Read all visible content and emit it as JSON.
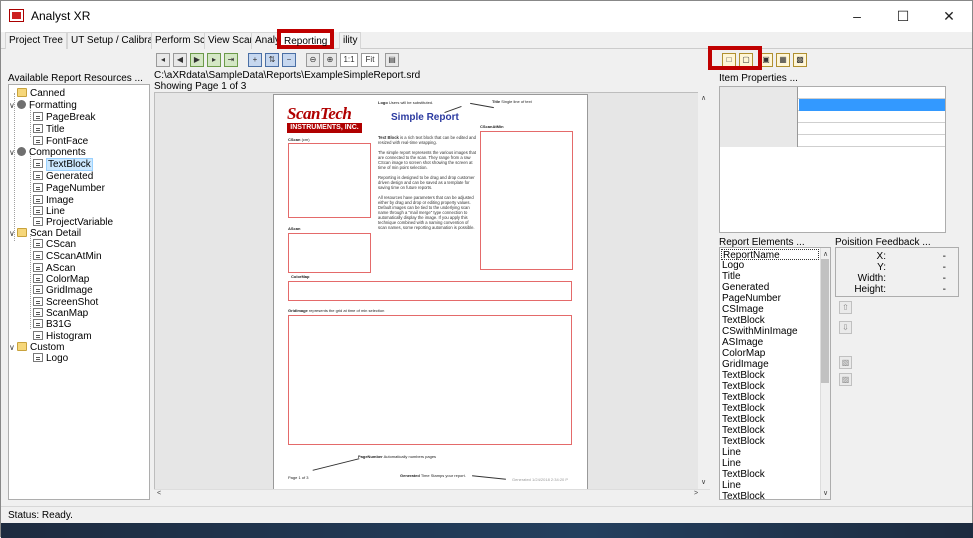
{
  "window": {
    "title": "Analyst XR",
    "minimize": "–",
    "maximize": "☐",
    "close": "✕"
  },
  "tabs": [
    {
      "label": "Project Tree"
    },
    {
      "label": "UT Setup / Calibration"
    },
    {
      "label": "Perform Scan"
    },
    {
      "label": "View Scan"
    },
    {
      "label": "Analysis"
    },
    {
      "label": "Reporting",
      "active": true
    },
    {
      "label": "ility"
    }
  ],
  "left_panel": {
    "label": "Available Report Resources ...",
    "tree": [
      {
        "label": "Canned",
        "icon": "folder-icon",
        "level": 0
      },
      {
        "label": "Formatting",
        "icon": "components-icon",
        "level": 0,
        "expanded": true
      },
      {
        "label": "PageBreak",
        "icon": "doc-icon",
        "level": 1
      },
      {
        "label": "Title",
        "icon": "doc-icon",
        "level": 1
      },
      {
        "label": "FontFace",
        "icon": "doc-icon",
        "level": 1
      },
      {
        "label": "Components",
        "icon": "components-icon",
        "level": 0,
        "expanded": true
      },
      {
        "label": "TextBlock",
        "icon": "doc-icon",
        "level": 1,
        "selected": true
      },
      {
        "label": "Generated",
        "icon": "doc-icon",
        "level": 1
      },
      {
        "label": "PageNumber",
        "icon": "doc-icon",
        "level": 1
      },
      {
        "label": "Image",
        "icon": "doc-icon",
        "level": 1
      },
      {
        "label": "Line",
        "icon": "doc-icon",
        "level": 1
      },
      {
        "label": "ProjectVariable",
        "icon": "doc-icon",
        "level": 1
      },
      {
        "label": "Scan Detail",
        "icon": "folder-icon",
        "level": 0,
        "expanded": true
      },
      {
        "label": "CScan",
        "icon": "doc-icon",
        "level": 1
      },
      {
        "label": "CScanAtMin",
        "icon": "doc-icon",
        "level": 1
      },
      {
        "label": "AScan",
        "icon": "doc-icon",
        "level": 1
      },
      {
        "label": "ColorMap",
        "icon": "doc-icon",
        "level": 1
      },
      {
        "label": "GridImage",
        "icon": "doc-icon",
        "level": 1
      },
      {
        "label": "ScreenShot",
        "icon": "doc-icon",
        "level": 1
      },
      {
        "label": "ScanMap",
        "icon": "doc-icon",
        "level": 1
      },
      {
        "label": "B31G",
        "icon": "doc-icon",
        "level": 1
      },
      {
        "label": "Histogram",
        "icon": "doc-icon",
        "level": 1
      },
      {
        "label": "Custom",
        "icon": "folder-icon",
        "level": 0,
        "expanded": true
      },
      {
        "label": "Logo",
        "icon": "doc-icon",
        "level": 1
      }
    ]
  },
  "center": {
    "path": "C:\\aXRdata\\SampleData\\Reports\\ExampleSimpleReport.srd",
    "page_info": "Showing Page 1 of 3",
    "toolbar": [
      "1:1",
      "Fit"
    ],
    "report": {
      "logo_line1": "ScanTech",
      "logo_line2": "INSTRUMENTS, INC.",
      "title": "Simple Report",
      "logo_note_bold": "Logo",
      "logo_note": "Users will be substituted.",
      "title_note_bold": "Title",
      "title_note": "Single line of text",
      "cscan_label": "CScan",
      "cscan_unit": "(cm)",
      "cscanatmin_label": "CScanAtMin",
      "ascan_label": "AScan",
      "colormap_label": "ColorMap",
      "gridimage_label": "GridImage",
      "gridimage_note": "represents the grid at time of min selection",
      "textblock_p1_bold": "Text Block",
      "textblock_p1": "is a rich text block that can be edited and resized with real-time wrapping.",
      "textblock_p2": "The simple report represents the various images that are connected to the scan. They range from a raw CScan image to screen shot showing the screen at time of min point selection.",
      "textblock_p3": "Reporting is designed to be drag and drop customer driven design and can be saved as a template for saving time on future reports.",
      "textblock_p4": "All resources have parameters that can be adjusted either by drag and drop or editing property values. Default images can be tied to the underlying scan name through a \"mail merge\" type connection to automatically display the image. If you apply this technique combined with a naming convention of scan names, some reporting automation is possible.",
      "pagenumber_bold": "PageNumber",
      "pagenumber_note": "Automatically numbers pages",
      "page_of": "Page 1 of 3",
      "generated_bold": "Generated",
      "generated_note": "Time Stamps your report.",
      "generated_value": "Generated 1/24/2018 2:34:20 P"
    }
  },
  "right_panel": {
    "item_properties_label": "Item Properties ...",
    "report_elements_label": "Report Elements ...",
    "position_feedback_label": "Poisition Feedback ...",
    "report_elements": [
      "ReportName",
      "Logo",
      "Title",
      "Generated",
      "PageNumber",
      "CSImage",
      "TextBlock",
      "CSwithMinImage",
      "ASImage",
      "ColorMap",
      "GridImage",
      "TextBlock",
      "TextBlock",
      "TextBlock",
      "TextBlock",
      "TextBlock",
      "TextBlock",
      "TextBlock",
      "Line",
      "Line",
      "TextBlock",
      "Line",
      "TextBlock"
    ],
    "position_feedback": [
      {
        "key": "X:",
        "value": "-"
      },
      {
        "key": "Y:",
        "value": "-"
      },
      {
        "key": "Width:",
        "value": "-"
      },
      {
        "key": "Height:",
        "value": "-"
      }
    ]
  },
  "status": {
    "text": "Status: Ready."
  },
  "colors": {
    "accent_red": "#c00000",
    "selection": "#3399ff",
    "title_blue": "#2b3aa0"
  }
}
